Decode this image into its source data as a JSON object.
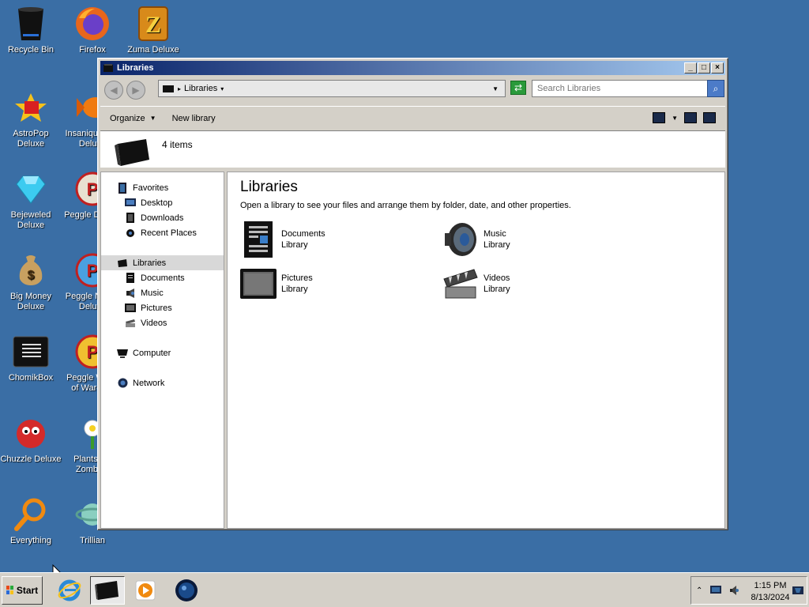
{
  "desktop": {
    "icons": [
      {
        "label": "Recycle Bin",
        "icon": "recycle-bin-icon"
      },
      {
        "label": "Firefox",
        "icon": "firefox-icon"
      },
      {
        "label": "Zuma Deluxe",
        "icon": "zuma-icon"
      },
      {
        "label": "AstroPop Deluxe",
        "icon": "astropop-icon"
      },
      {
        "label": "Insaniquarium Deluxe",
        "icon": "insaniquarium-icon"
      },
      {
        "label": "Bejeweled Deluxe",
        "icon": "bejeweled-icon"
      },
      {
        "label": "Peggle Deluxe",
        "icon": "peggle-icon"
      },
      {
        "label": "Big Money Deluxe",
        "icon": "big-money-icon"
      },
      {
        "label": "Peggle Nights Deluxe",
        "icon": "peggle-nights-icon"
      },
      {
        "label": "ChomikBox",
        "icon": "chomikbox-icon"
      },
      {
        "label": "Peggle World of Warcraft",
        "icon": "peggle-wow-icon"
      },
      {
        "label": "Chuzzle Deluxe",
        "icon": "chuzzle-icon"
      },
      {
        "label": "Plants vs. Zombies",
        "icon": "plants-zombies-icon"
      },
      {
        "label": "Everything",
        "icon": "everything-icon"
      },
      {
        "label": "Trillian",
        "icon": "trillian-icon"
      }
    ]
  },
  "window": {
    "title": "Libraries",
    "breadcrumb": "Libraries",
    "search_placeholder": "Search Libraries",
    "toolbar": {
      "organize": "Organize",
      "new_library": "New library"
    },
    "details": {
      "count": "4 items"
    },
    "nav": {
      "favorites": "Favorites",
      "desktop": "Desktop",
      "downloads": "Downloads",
      "recent": "Recent Places",
      "libraries": "Libraries",
      "documents": "Documents",
      "music": "Music",
      "pictures": "Pictures",
      "videos": "Videos",
      "computer": "Computer",
      "network": "Network"
    },
    "content": {
      "heading": "Libraries",
      "description": "Open a library to see your files and arrange them by folder, date, and other properties.",
      "libraries": [
        {
          "name": "Documents",
          "type": "Library"
        },
        {
          "name": "Music",
          "type": "Library"
        },
        {
          "name": "Pictures",
          "type": "Library"
        },
        {
          "name": "Videos",
          "type": "Library"
        }
      ]
    }
  },
  "taskbar": {
    "start_label": "Start",
    "time": "1:15 PM",
    "date": "8/13/2024"
  }
}
